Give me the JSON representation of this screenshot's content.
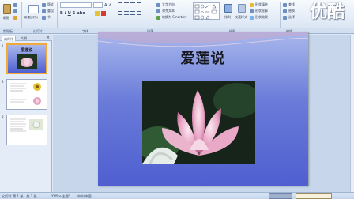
{
  "ribbon": {
    "paste_label": "粘贴",
    "new_slide_label": "新建幻灯片",
    "group_clipboard": "剪贴板",
    "group_slides": "幻灯片",
    "group_font": "字体",
    "group_paragraph": "段落",
    "group_drawing": "绘图",
    "group_editing": "编辑",
    "layout_label": "版式",
    "reset_label": "重设",
    "section_label": "节",
    "text_direction": "文字方向",
    "align_text": "对齐文本",
    "convert_smartart": "转换为 SmartArt",
    "shapes_label": "形状",
    "arrange_label": "排列",
    "quick_styles_label": "快速样式",
    "shape_fill": "形状填充",
    "shape_outline": "形状轮廓",
    "shape_effects": "形状效果",
    "find_label": "查找",
    "replace_label": "替换",
    "select_label": "选择",
    "watermark": "优酷"
  },
  "left_pane": {
    "tab_slides": "幻灯片",
    "tab_outline": "大纲",
    "slide_numbers": [
      "1",
      "2",
      "3"
    ]
  },
  "slide": {
    "title": "爱莲说"
  },
  "status": {
    "slide_info": "幻灯片 第 1 张，共 3 张",
    "theme": "\"Office 主题\"",
    "language": "中文(中国)"
  },
  "colors": {
    "slide_top": "#a9b8ec",
    "slide_bottom": "#4f5fd0",
    "ribbon_bg": "#dbe6f4"
  }
}
